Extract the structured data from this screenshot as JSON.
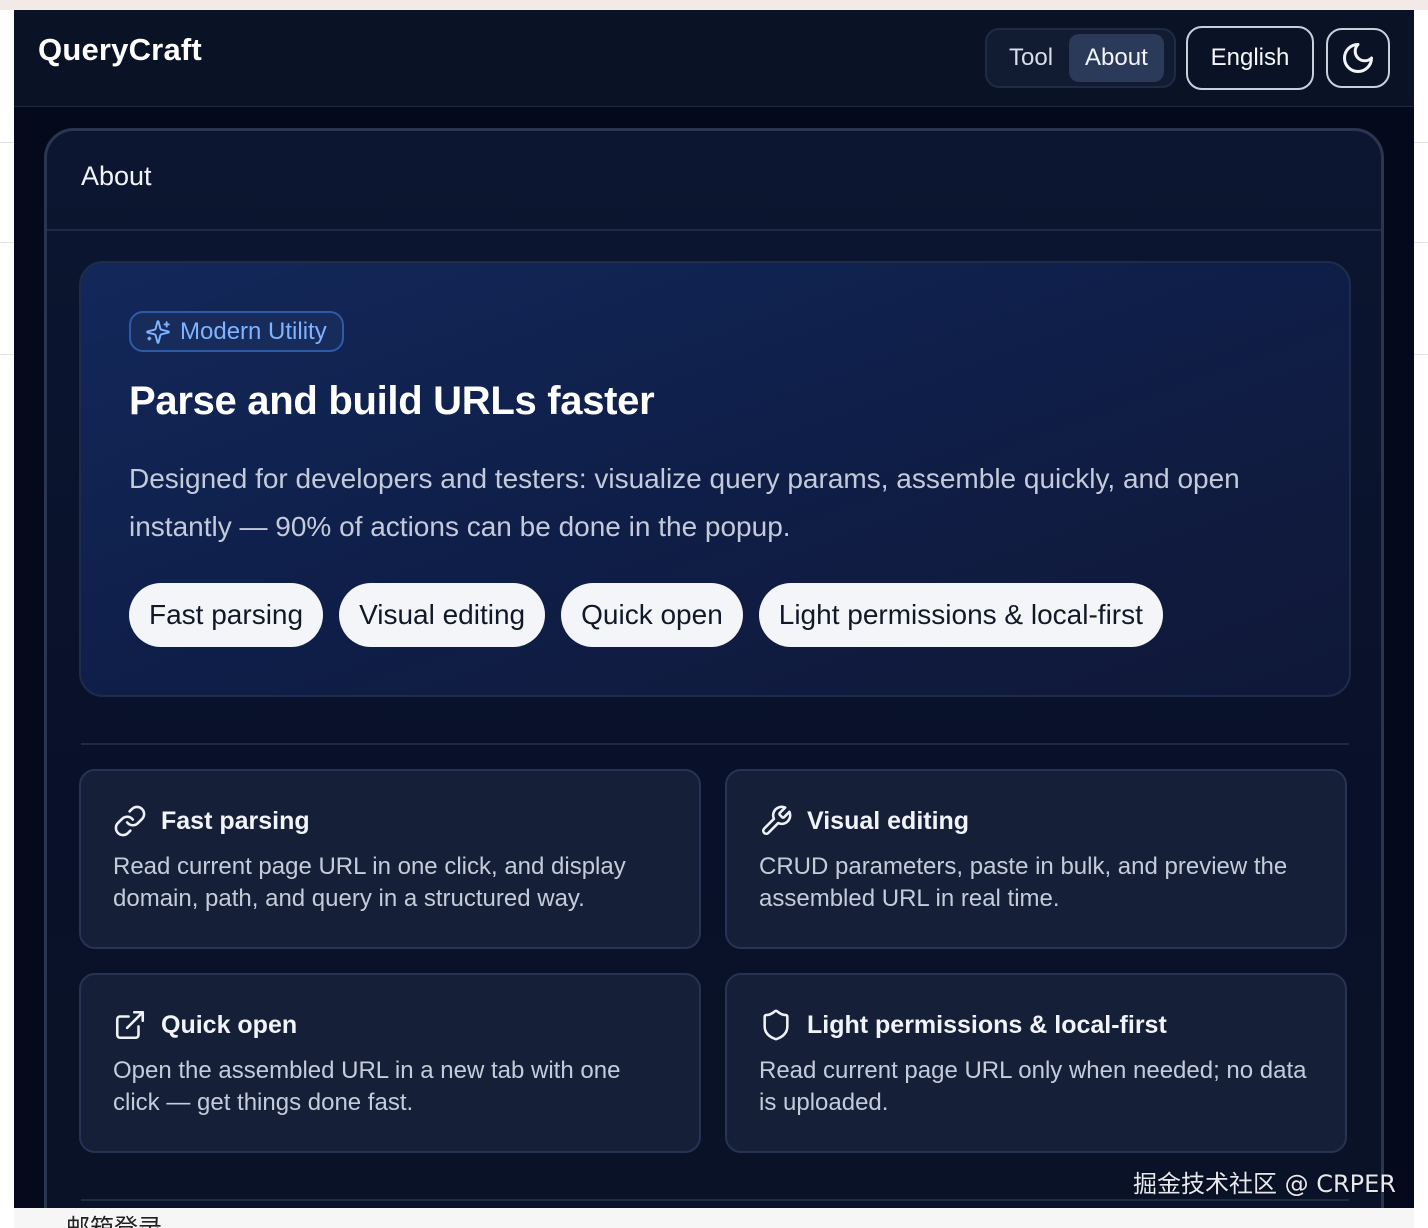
{
  "app": {
    "title": "QueryCraft"
  },
  "nav": {
    "tabs": [
      {
        "label": "Tool",
        "active": false
      },
      {
        "label": "About",
        "active": true
      }
    ],
    "language": "English",
    "theme_icon": "moon-icon"
  },
  "about": {
    "header": "About",
    "badge": {
      "icon": "sparkles-icon",
      "label": "Modern Utility"
    },
    "title": "Parse and build URLs faster",
    "description": "Designed for developers and testers: visualize query params, assemble quickly, and open instantly — 90% of actions can be done in the popup.",
    "chips": [
      "Fast parsing",
      "Visual editing",
      "Quick open",
      "Light permissions & local-first"
    ],
    "features": [
      {
        "icon": "link-icon",
        "title": "Fast parsing",
        "desc": "Read current page URL in one click, and display domain, path, and query in a structured way."
      },
      {
        "icon": "wrench-icon",
        "title": "Visual editing",
        "desc": "CRUD parameters, paste in bulk, and preview the assembled URL in real time."
      },
      {
        "icon": "external-link-icon",
        "title": "Quick open",
        "desc": "Open the assembled URL in a new tab with one click — get things done fast."
      },
      {
        "icon": "shield-icon",
        "title": "Light permissions & local-first",
        "desc": "Read current page URL only when needed; no data is uploaded."
      }
    ]
  },
  "background": {
    "bottom_text": "邮箱登录"
  },
  "watermark": "掘金技术社区 @ CRPER",
  "colors": {
    "accent": "#7fb2ff",
    "background": "#040a1c",
    "hero": "#13285a"
  }
}
